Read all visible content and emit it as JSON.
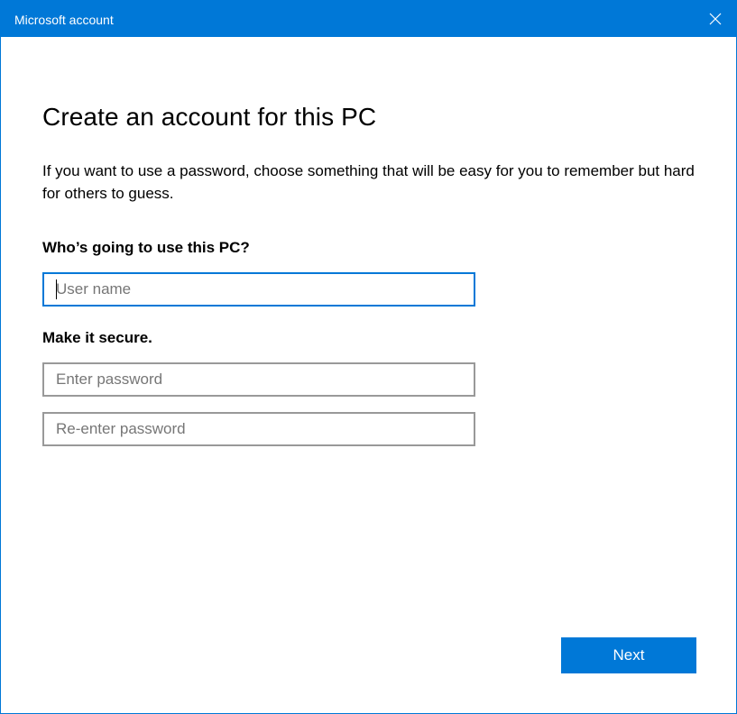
{
  "window": {
    "title": "Microsoft account",
    "close_icon": "close-icon",
    "accent_color": "#0078d7"
  },
  "main": {
    "heading": "Create an account for this PC",
    "description": "If you want to use a password, choose something that will be easy for you to remember but hard for others to guess.",
    "who_label": "Who’s going to use this PC?",
    "username_placeholder": "User name",
    "username_value": "",
    "secure_label": "Make it secure.",
    "password_placeholder": "Enter password",
    "password_value": "",
    "reenter_placeholder": "Re-enter password",
    "reenter_value": ""
  },
  "footer": {
    "next_label": "Next"
  }
}
